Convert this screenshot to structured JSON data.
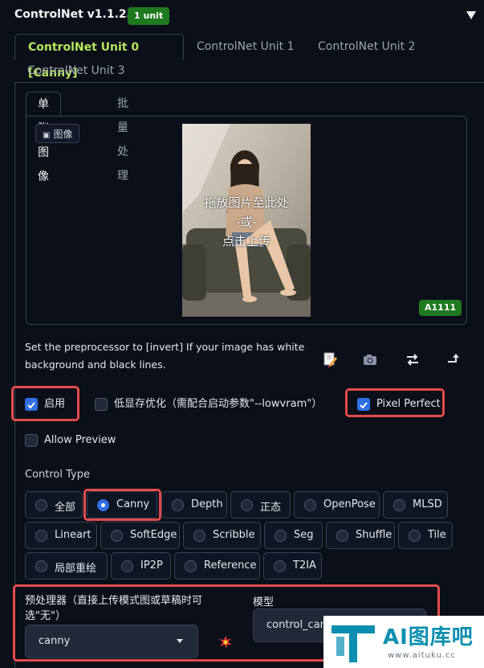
{
  "header": {
    "title": "ControlNet v1.1.230",
    "units_badge": "1 unit"
  },
  "unit_tabs": [
    "ControlNet Unit 0 [Canny]",
    "ControlNet Unit 1",
    "ControlNet Unit 2",
    "ControlNet Unit 3"
  ],
  "image_tabs": [
    "单张图像",
    "批量处理"
  ],
  "image_area": {
    "label": "图像",
    "drop_text_line1": "拖放图片至此处",
    "drop_text_line2": "-或-",
    "drop_text_line3": "点击上传",
    "badge": "A1111"
  },
  "hint": "Set the preprocessor to [invert] If your image has white background and black lines.",
  "options": {
    "enable": {
      "label": "启用",
      "checked": true
    },
    "lowvram": {
      "label": "低显存优化（需配合启动参数\"--lowvram\"）",
      "checked": false
    },
    "pixel_perfect": {
      "label": "Pixel Perfect",
      "checked": true
    },
    "allow_preview": {
      "label": "Allow Preview",
      "checked": false
    }
  },
  "control_type": {
    "label": "Control Type",
    "selected": "Canny",
    "rows": [
      [
        "全部",
        "Canny",
        "Depth",
        "正态",
        "OpenPose",
        "MLSD"
      ],
      [
        "Lineart",
        "SoftEdge",
        "Scribble",
        "Seg",
        "Shuffle",
        "Tile"
      ],
      [
        "局部重绘",
        "IP2P",
        "Reference",
        "T2IA"
      ]
    ]
  },
  "preprocessor": {
    "label": "预处理器（直接上传模式图或草稿时可选\"无\"）",
    "value": "canny"
  },
  "model": {
    "label": "模型",
    "value": "control_canny"
  },
  "watermark": {
    "title": "AI图库吧",
    "url": "www.aituku.cc"
  },
  "colors": {
    "accent_green": "#b5e65a",
    "badge_green": "#1f7a1f",
    "highlight_red": "#e24c4c",
    "check_blue": "#2f6fe4"
  }
}
